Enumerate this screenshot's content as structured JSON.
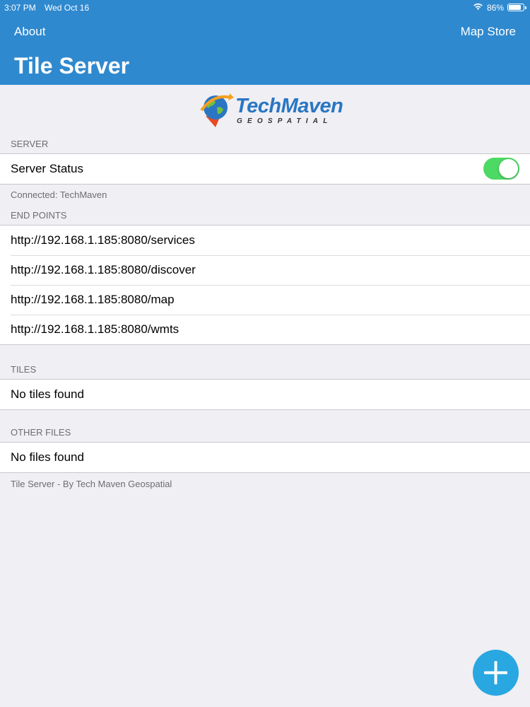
{
  "status_bar": {
    "time": "3:07 PM",
    "date": "Wed Oct 16",
    "battery": "86%"
  },
  "nav": {
    "left_button": "About",
    "right_button": "Map Store",
    "title": "Tile Server"
  },
  "logo": {
    "brand_tech": "Tech",
    "brand_maven": "Maven",
    "subtitle": "GEOSPATIAL"
  },
  "server": {
    "header": "SERVER",
    "status_label": "Server Status",
    "status_on": true,
    "footer": "Connected: TechMaven"
  },
  "endpoints": {
    "header": "END POINTS",
    "items": [
      "http://192.168.1.185:8080/services",
      "http://192.168.1.185:8080/discover",
      "http://192.168.1.185:8080/map",
      "http://192.168.1.185:8080/wmts"
    ]
  },
  "tiles": {
    "header": "TILES",
    "empty_text": "No tiles found"
  },
  "other_files": {
    "header": "OTHER FILES",
    "empty_text": "No files found"
  },
  "footer": "Tile Server - By Tech Maven Geospatial",
  "colors": {
    "nav_bar": "#2f89cf",
    "toggle_on": "#4cd964",
    "fab": "#29a7e1"
  },
  "icons": {
    "add_button": "plus-icon",
    "wifi": "wifi-icon",
    "battery": "battery-icon"
  }
}
